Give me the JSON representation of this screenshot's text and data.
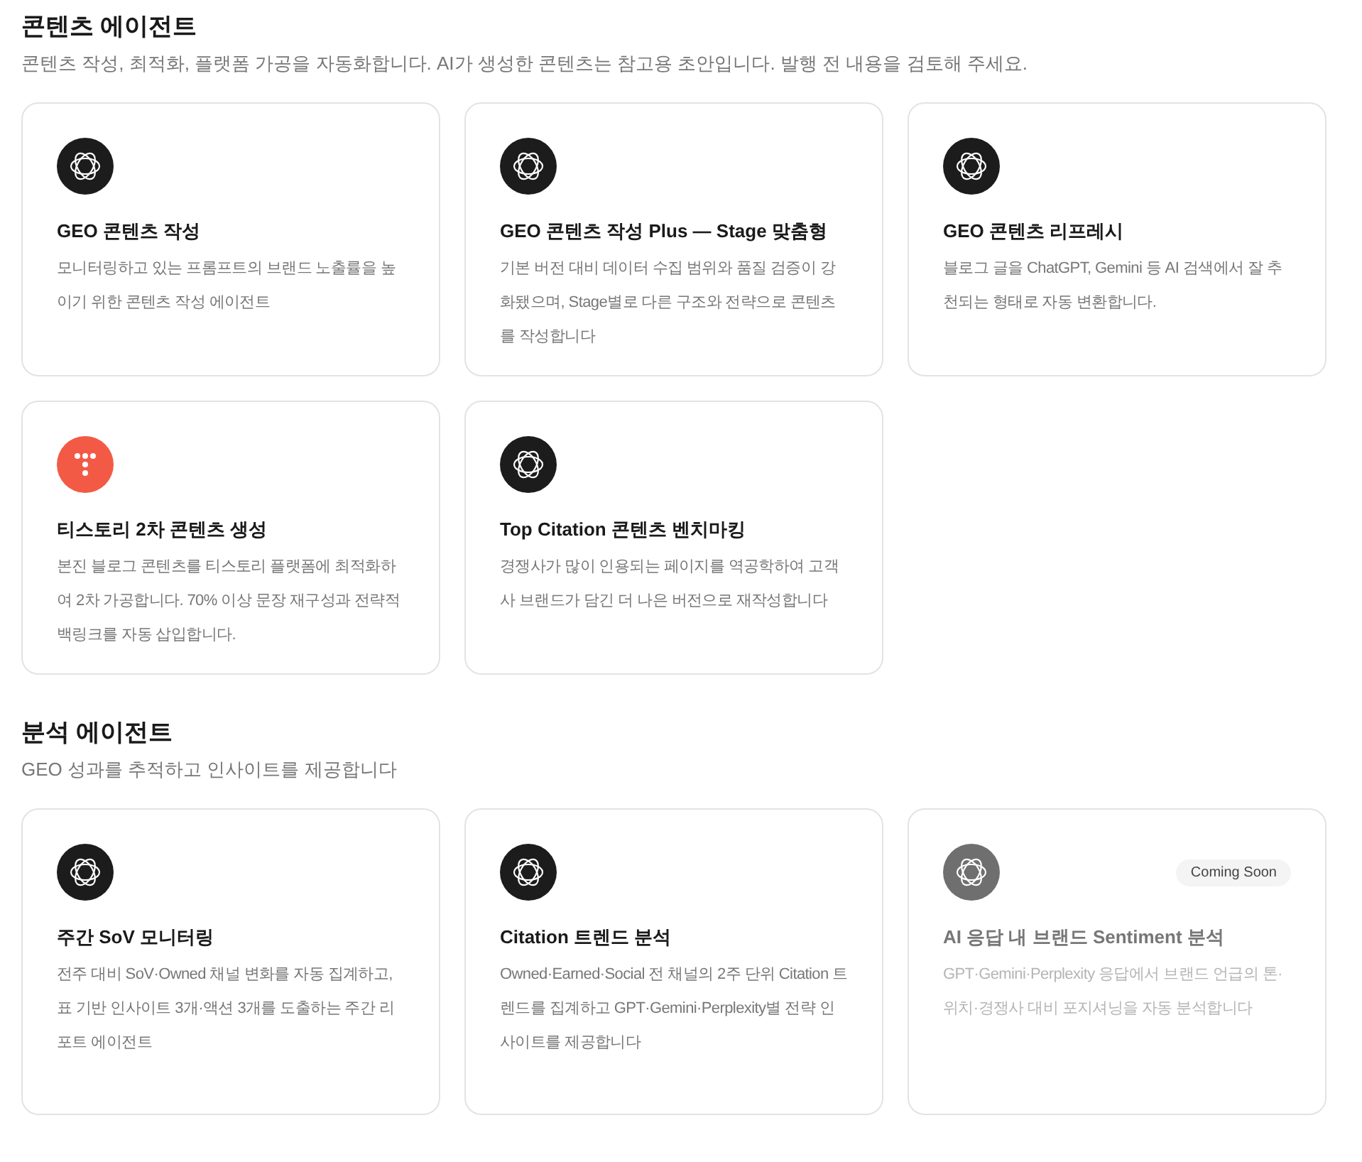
{
  "sections": [
    {
      "title": "콘텐츠 에이전트",
      "description": "콘텐츠 작성, 최적화, 플랫폼 가공을 자동화합니다. AI가 생성한 콘텐츠는 참고용 초안입니다. 발행 전 내용을 검토해 주세요.",
      "cards": [
        {
          "kind": "orbit",
          "title": "GEO 콘텐츠 작성",
          "description": "모니터링하고 있는 프롬프트의 브랜드 노출률을 높이기 위한 콘텐츠 작성 에이전트",
          "disabled": false
        },
        {
          "kind": "orbit",
          "title": "GEO 콘텐츠 작성 Plus — Stage 맞춤형",
          "description": "기본 버전 대비 데이터 수집 범위와 품질 검증이 강화됐으며, Stage별로 다른 구조와 전략으로 콘텐츠를 작성합니다",
          "disabled": false
        },
        {
          "kind": "orbit",
          "title": "GEO 콘텐츠 리프레시",
          "description": "블로그 글을 ChatGPT, Gemini 등 AI 검색에서 잘 추천되는 형태로 자동 변환합니다.",
          "disabled": false
        },
        {
          "kind": "tistory",
          "title": "티스토리 2차 콘텐츠 생성",
          "description": "본진 블로그 콘텐츠를 티스토리 플랫폼에 최적화하여 2차 가공합니다. 70% 이상 문장 재구성과 전략적 백링크를 자동 삽입합니다.",
          "disabled": false
        },
        {
          "kind": "orbit",
          "title": "Top Citation 콘텐츠 벤치마킹",
          "description": "경쟁사가 많이 인용되는 페이지를 역공학하여 고객사 브랜드가 담긴 더 나은 버전으로 재작성합니다",
          "disabled": false
        }
      ]
    },
    {
      "title": "분석 에이전트",
      "description": "GEO 성과를 추적하고 인사이트를 제공합니다",
      "cards": [
        {
          "kind": "orbit",
          "title": "주간 SoV 모니터링",
          "description": "전주 대비 SoV·Owned 채널 변화를 자동 집계하고, 표 기반 인사이트 3개·액션 3개를 도출하는 주간 리포트 에이전트",
          "disabled": false
        },
        {
          "kind": "orbit",
          "title": "Citation 트렌드 분석",
          "description": "Owned·Earned·Social 전 채널의 2주 단위 Citation 트렌드를 집계하고 GPT·Gemini·Perplexity별 전략 인사이트를 제공합니다",
          "disabled": false
        },
        {
          "kind": "orbit",
          "title": "AI 응답 내 브랜드 Sentiment 분석",
          "description": "GPT·Gemini·Perplexity 응답에서 브랜드 언급의 톤·위치·경쟁사 대비 포지셔닝을 자동 분석합니다",
          "disabled": true,
          "badge": "Coming Soon"
        }
      ]
    }
  ]
}
